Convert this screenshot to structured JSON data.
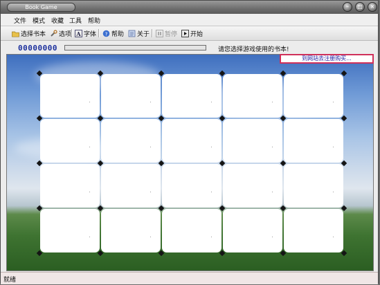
{
  "window": {
    "title": "Book Game"
  },
  "titlebar": {
    "minimize_glyph": "–",
    "maximize_glyph": "□",
    "close_glyph": "×"
  },
  "menu": {
    "items": [
      "文件",
      "模式",
      "收藏",
      "工具",
      "帮助"
    ]
  },
  "toolbar": {
    "select_book": "选择书本",
    "options": "选项",
    "font": "字体",
    "help": "帮助",
    "about": "关于",
    "pause": "暂停",
    "start": "开始",
    "font_glyph": "A"
  },
  "status": {
    "counter": "00000000",
    "progress_fraction": 0,
    "hint": "请您选择游戏使用的书本!"
  },
  "register_link": "到网站去注册购买...",
  "board": {
    "rows": 4,
    "cols": 5
  },
  "statusbar": {
    "text": "就绪"
  },
  "colors": {
    "counter": "#1a2e9c",
    "register_border": "#d0305a",
    "register_text": "#1a1aa0"
  }
}
